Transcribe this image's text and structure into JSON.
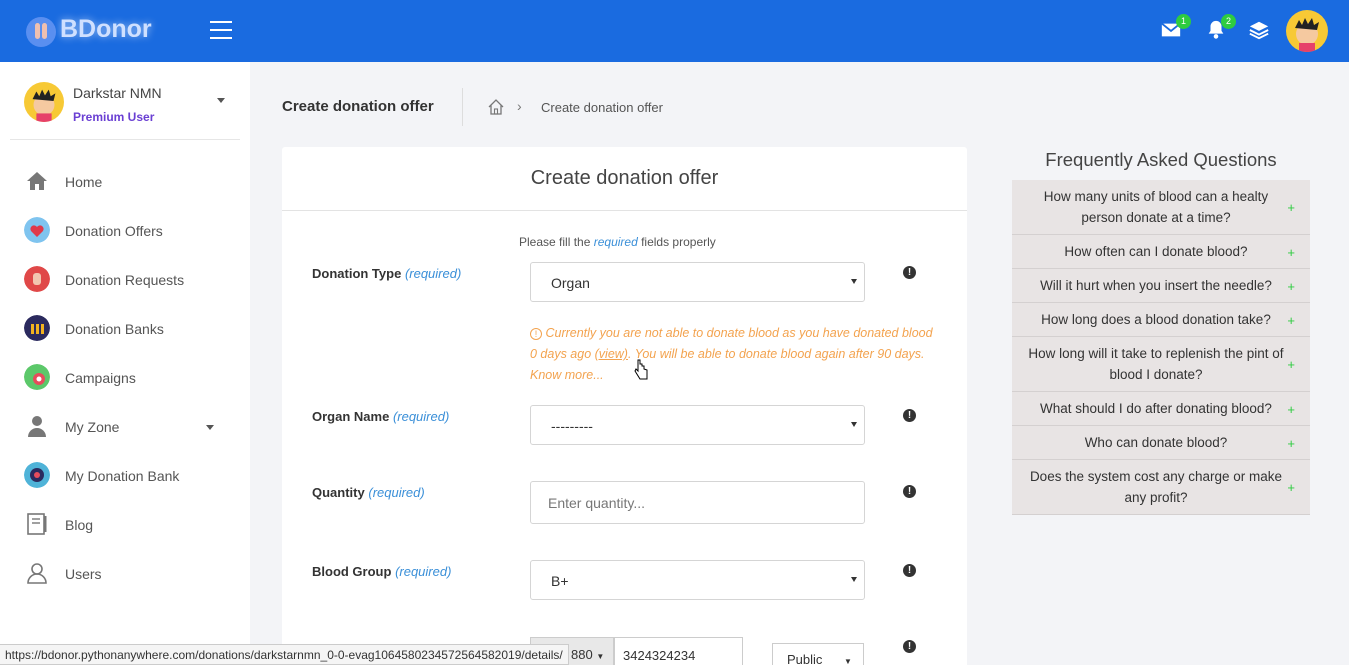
{
  "brand": {
    "name": "BDonor"
  },
  "header": {
    "messages_count": "1",
    "notifications_count": "2"
  },
  "user": {
    "name": "Darkstar NMN",
    "role": "Premium User"
  },
  "sidebar": {
    "items": [
      {
        "label": "Home",
        "icon": "home-icon"
      },
      {
        "label": "Donation Offers",
        "icon": "heart-icon"
      },
      {
        "label": "Donation Requests",
        "icon": "hand-icon"
      },
      {
        "label": "Donation Banks",
        "icon": "bank-icon"
      },
      {
        "label": "Campaigns",
        "icon": "campaign-icon"
      },
      {
        "label": "My Zone",
        "icon": "person-icon"
      },
      {
        "label": "My Donation Bank",
        "icon": "donation-bank-icon"
      },
      {
        "label": "Blog",
        "icon": "blog-icon"
      },
      {
        "label": "Users",
        "icon": "users-icon"
      }
    ]
  },
  "page": {
    "title": "Create donation offer",
    "breadcrumb_current": "Create donation offer"
  },
  "form": {
    "title": "Create donation offer",
    "instruction_prefix": "Please fill the ",
    "instruction_required": "required",
    "instruction_suffix": " fields properly",
    "required_text": "(required)",
    "donation_type": {
      "label": "Donation Type",
      "value": "Organ"
    },
    "warning": {
      "icon": "!",
      "text_before": " Currently you are not able to donate blood as you have donated blood 0 days ago ",
      "view_link": "(view)",
      "text_after": ". You will be able to donate blood again after 90 days. Know more..."
    },
    "organ_name": {
      "label": "Organ Name",
      "value": "---------"
    },
    "quantity": {
      "label": "Quantity",
      "placeholder": "Enter quantity..."
    },
    "blood_group": {
      "label": "Blood Group",
      "value": "B+"
    },
    "contact": {
      "prefix": "880",
      "number": "3424324234",
      "visibility": "Public"
    }
  },
  "faq": {
    "title": "Frequently Asked Questions",
    "items": [
      "How many units of blood can a healty person donate at a time?",
      "How often can I donate blood?",
      "Will it hurt when you insert the needle?",
      "How long does a blood donation take?",
      "How long will it take to replenish the pint of blood I donate?",
      "What should I do after donating blood?",
      "Who can donate blood?",
      "Does the system cost any charge or make any profit?"
    ],
    "plus": "+"
  },
  "statusbar": {
    "url": "https://bdonor.pythonanywhere.com/donations/darkstarnmn_0-0-evag1064580234572564582019/details/"
  },
  "colors": {
    "primary": "#1a6be0",
    "warning": "#f3a34f",
    "required": "#3a8fd8",
    "badge": "#2ecc40",
    "premium": "#6a3fd3"
  }
}
